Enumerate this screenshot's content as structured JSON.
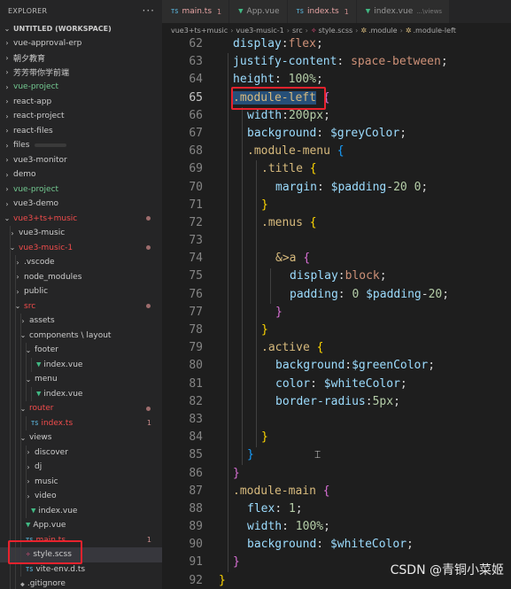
{
  "sidebar": {
    "title": "EXPLORER",
    "more": "···",
    "items": [
      {
        "chev": "⌄",
        "label": "UNTITLED (WORKSPACE)",
        "depth": 0,
        "style": "",
        "header": true
      },
      {
        "chev": "›",
        "label": "vue-approval-erp",
        "depth": 0,
        "style": ""
      },
      {
        "chev": "›",
        "label": "朝夕教育",
        "depth": 0,
        "style": ""
      },
      {
        "chev": "›",
        "label": "芳芳带你学前端",
        "depth": 0,
        "style": ""
      },
      {
        "chev": "›",
        "label": "vue-project",
        "depth": 0,
        "style": "green"
      },
      {
        "chev": "›",
        "label": "react-app",
        "depth": 0,
        "style": ""
      },
      {
        "chev": "›",
        "label": "react-project",
        "depth": 0,
        "style": ""
      },
      {
        "chev": "›",
        "label": "react-files",
        "depth": 0,
        "style": ""
      },
      {
        "chev": "›",
        "label": "files",
        "depth": 0,
        "style": "",
        "redacted": true
      },
      {
        "chev": "›",
        "label": "vue3-monitor",
        "depth": 0,
        "style": ""
      },
      {
        "chev": "›",
        "label": "demo",
        "depth": 0,
        "style": ""
      },
      {
        "chev": "›",
        "label": "vue-project",
        "depth": 0,
        "style": "green"
      },
      {
        "chev": "›",
        "label": "vue3-demo",
        "depth": 0,
        "style": ""
      },
      {
        "chev": "⌄",
        "label": "vue3+ts+music",
        "depth": 0,
        "style": "red",
        "dot": true
      },
      {
        "chev": "›",
        "label": "vue3-music",
        "depth": 1,
        "style": ""
      },
      {
        "chev": "⌄",
        "label": "vue3-music-1",
        "depth": 1,
        "style": "red",
        "dot": true
      },
      {
        "chev": "›",
        "label": ".vscode",
        "depth": 2,
        "style": ""
      },
      {
        "chev": "›",
        "label": "node_modules",
        "depth": 2,
        "style": ""
      },
      {
        "chev": "›",
        "label": "public",
        "depth": 2,
        "style": ""
      },
      {
        "chev": "⌄",
        "label": "src",
        "depth": 2,
        "style": "red",
        "dot": true
      },
      {
        "chev": "›",
        "label": "assets",
        "depth": 3,
        "style": ""
      },
      {
        "chev": "⌄",
        "label": "components \\ layout",
        "depth": 3,
        "style": ""
      },
      {
        "chev": "⌄",
        "label": "footer",
        "depth": 4,
        "style": ""
      },
      {
        "chev": "",
        "icon": "vue",
        "label": "index.vue",
        "depth": 5,
        "style": ""
      },
      {
        "chev": "⌄",
        "label": "menu",
        "depth": 4,
        "style": ""
      },
      {
        "chev": "",
        "icon": "vue",
        "label": "index.vue",
        "depth": 5,
        "style": ""
      },
      {
        "chev": "⌄",
        "label": "router",
        "depth": 3,
        "style": "red",
        "dot": true
      },
      {
        "chev": "",
        "icon": "ts",
        "label": "index.ts",
        "depth": 4,
        "style": "red",
        "badge": "1"
      },
      {
        "chev": "⌄",
        "label": "views",
        "depth": 3,
        "style": ""
      },
      {
        "chev": "›",
        "label": "discover",
        "depth": 4,
        "style": ""
      },
      {
        "chev": "›",
        "label": "dj",
        "depth": 4,
        "style": ""
      },
      {
        "chev": "›",
        "label": "music",
        "depth": 4,
        "style": ""
      },
      {
        "chev": "›",
        "label": "video",
        "depth": 4,
        "style": ""
      },
      {
        "chev": "",
        "icon": "vue",
        "label": "index.vue",
        "depth": 4,
        "style": ""
      },
      {
        "chev": "",
        "icon": "vue",
        "label": "App.vue",
        "depth": 3,
        "style": ""
      },
      {
        "chev": "",
        "icon": "ts",
        "label": "main.ts",
        "depth": 3,
        "style": "red",
        "badge": "1"
      },
      {
        "chev": "",
        "icon": "scss",
        "label": "style.scss",
        "depth": 3,
        "style": "",
        "selected": true
      },
      {
        "chev": "",
        "icon": "ts",
        "label": "vite-env.d.ts",
        "depth": 3,
        "style": ""
      },
      {
        "chev": "",
        "icon": "git",
        "label": ".gitignore",
        "depth": 2,
        "style": ""
      }
    ]
  },
  "tabs": [
    {
      "icon": "TS",
      "kind": "ts",
      "name": "main.ts",
      "count": "1",
      "desc": "",
      "red": true
    },
    {
      "icon": "▼",
      "kind": "vue",
      "name": "App.vue",
      "count": "",
      "desc": "",
      "red": false
    },
    {
      "icon": "TS",
      "kind": "ts",
      "name": "index.ts",
      "count": "1",
      "desc": "",
      "red": true
    },
    {
      "icon": "▼",
      "kind": "vue",
      "name": "index.vue",
      "count": "",
      "desc": "...\\views",
      "red": false
    }
  ],
  "breadcrumb": {
    "parts": [
      "vue3+ts+music",
      "vue3-music-1",
      "src"
    ],
    "file": "style.scss",
    "symbols": [
      ".module",
      ".module-left"
    ]
  },
  "editor": {
    "current_line": "65",
    "lines": [
      {
        "n": "62",
        "indent": 1,
        "tokens": [
          [
            "prop",
            "display"
          ],
          [
            "punc",
            ":"
          ],
          [
            "val",
            "flex"
          ],
          [
            "punc",
            ";"
          ]
        ]
      },
      {
        "n": "63",
        "indent": 1,
        "tokens": [
          [
            "prop",
            "justify-content"
          ],
          [
            "punc",
            ": "
          ],
          [
            "val",
            "space-between"
          ],
          [
            "punc",
            ";"
          ]
        ]
      },
      {
        "n": "64",
        "indent": 1,
        "tokens": [
          [
            "prop",
            "height"
          ],
          [
            "punc",
            ": "
          ],
          [
            "num",
            "100%"
          ],
          [
            "punc",
            ";"
          ]
        ]
      },
      {
        "n": "65",
        "indent": 1,
        "tokens": [
          [
            "sel-hl",
            ".module-left"
          ],
          [
            "punc",
            " "
          ],
          [
            "b2",
            "{"
          ]
        ]
      },
      {
        "n": "66",
        "indent": 2,
        "tokens": [
          [
            "prop",
            "width"
          ],
          [
            "punc",
            ":"
          ],
          [
            "num",
            "200px"
          ],
          [
            "punc",
            ";"
          ]
        ]
      },
      {
        "n": "67",
        "indent": 2,
        "tokens": [
          [
            "prop",
            "background"
          ],
          [
            "punc",
            ": "
          ],
          [
            "var",
            "$greyColor"
          ],
          [
            "punc",
            ";"
          ]
        ]
      },
      {
        "n": "68",
        "indent": 2,
        "tokens": [
          [
            "sel",
            ".module-menu"
          ],
          [
            "punc",
            " "
          ],
          [
            "b3",
            "{"
          ]
        ]
      },
      {
        "n": "69",
        "indent": 3,
        "tokens": [
          [
            "sel",
            ".title"
          ],
          [
            "punc",
            " "
          ],
          [
            "b1",
            "{"
          ]
        ]
      },
      {
        "n": "70",
        "indent": 4,
        "tokens": [
          [
            "prop",
            "margin"
          ],
          [
            "punc",
            ": "
          ],
          [
            "var",
            "$padding"
          ],
          [
            "op",
            "-"
          ],
          [
            "num",
            "20"
          ],
          [
            "punc",
            " "
          ],
          [
            "num",
            "0"
          ],
          [
            "punc",
            ";"
          ]
        ]
      },
      {
        "n": "71",
        "indent": 3,
        "tokens": [
          [
            "b1",
            "}"
          ]
        ]
      },
      {
        "n": "72",
        "indent": 3,
        "tokens": [
          [
            "sel",
            ".menus"
          ],
          [
            "punc",
            " "
          ],
          [
            "b1",
            "{"
          ]
        ]
      },
      {
        "n": "73",
        "indent": 0,
        "tokens": []
      },
      {
        "n": "74",
        "indent": 4,
        "tokens": [
          [
            "sel",
            "&>a"
          ],
          [
            "punc",
            " "
          ],
          [
            "b2",
            "{"
          ]
        ]
      },
      {
        "n": "75",
        "indent": 5,
        "tokens": [
          [
            "prop",
            "display"
          ],
          [
            "punc",
            ":"
          ],
          [
            "val",
            "block"
          ],
          [
            "punc",
            ";"
          ]
        ]
      },
      {
        "n": "76",
        "indent": 5,
        "tokens": [
          [
            "prop",
            "padding"
          ],
          [
            "punc",
            ": "
          ],
          [
            "num",
            "0"
          ],
          [
            "punc",
            " "
          ],
          [
            "var",
            "$padding"
          ],
          [
            "op",
            "-"
          ],
          [
            "num",
            "20"
          ],
          [
            "punc",
            ";"
          ]
        ]
      },
      {
        "n": "77",
        "indent": 4,
        "tokens": [
          [
            "b2",
            "}"
          ]
        ]
      },
      {
        "n": "78",
        "indent": 3,
        "tokens": [
          [
            "b1",
            "}"
          ]
        ]
      },
      {
        "n": "79",
        "indent": 3,
        "tokens": [
          [
            "sel",
            ".active"
          ],
          [
            "punc",
            " "
          ],
          [
            "b1",
            "{"
          ]
        ]
      },
      {
        "n": "80",
        "indent": 4,
        "tokens": [
          [
            "prop",
            "background"
          ],
          [
            "punc",
            ":"
          ],
          [
            "var",
            "$greenColor"
          ],
          [
            "punc",
            ";"
          ]
        ]
      },
      {
        "n": "81",
        "indent": 4,
        "tokens": [
          [
            "prop",
            "color"
          ],
          [
            "punc",
            ": "
          ],
          [
            "var",
            "$whiteColor"
          ],
          [
            "punc",
            ";"
          ]
        ]
      },
      {
        "n": "82",
        "indent": 4,
        "tokens": [
          [
            "prop",
            "border-radius"
          ],
          [
            "punc",
            ":"
          ],
          [
            "num",
            "5px"
          ],
          [
            "punc",
            ";"
          ]
        ]
      },
      {
        "n": "83",
        "indent": 0,
        "tokens": []
      },
      {
        "n": "84",
        "indent": 3,
        "tokens": [
          [
            "b1",
            "}"
          ]
        ]
      },
      {
        "n": "85",
        "indent": 2,
        "tokens": [
          [
            "b3",
            "}"
          ]
        ]
      },
      {
        "n": "86",
        "indent": 1,
        "tokens": [
          [
            "b2",
            "}"
          ]
        ]
      },
      {
        "n": "87",
        "indent": 1,
        "tokens": [
          [
            "sel",
            ".module-main"
          ],
          [
            "punc",
            " "
          ],
          [
            "b2",
            "{"
          ]
        ]
      },
      {
        "n": "88",
        "indent": 2,
        "tokens": [
          [
            "prop",
            "flex"
          ],
          [
            "punc",
            ": "
          ],
          [
            "num",
            "1"
          ],
          [
            "punc",
            ";"
          ]
        ]
      },
      {
        "n": "89",
        "indent": 2,
        "tokens": [
          [
            "prop",
            "width"
          ],
          [
            "punc",
            ": "
          ],
          [
            "num",
            "100%"
          ],
          [
            "punc",
            ";"
          ]
        ]
      },
      {
        "n": "90",
        "indent": 2,
        "tokens": [
          [
            "prop",
            "background"
          ],
          [
            "punc",
            ": "
          ],
          [
            "var",
            "$whiteColor"
          ],
          [
            "punc",
            ";"
          ]
        ]
      },
      {
        "n": "91",
        "indent": 1,
        "tokens": [
          [
            "b2",
            "}"
          ]
        ]
      },
      {
        "n": "92",
        "indent": 0,
        "tokens": [
          [
            "b1",
            "}"
          ]
        ]
      }
    ]
  },
  "watermark": "CSDN @青铜小菜姬",
  "colors": {
    "annotation_red": "#e8222d",
    "editor_bg": "#1e1e1e",
    "sidebar_bg": "#252526",
    "selection": "#264f78"
  }
}
